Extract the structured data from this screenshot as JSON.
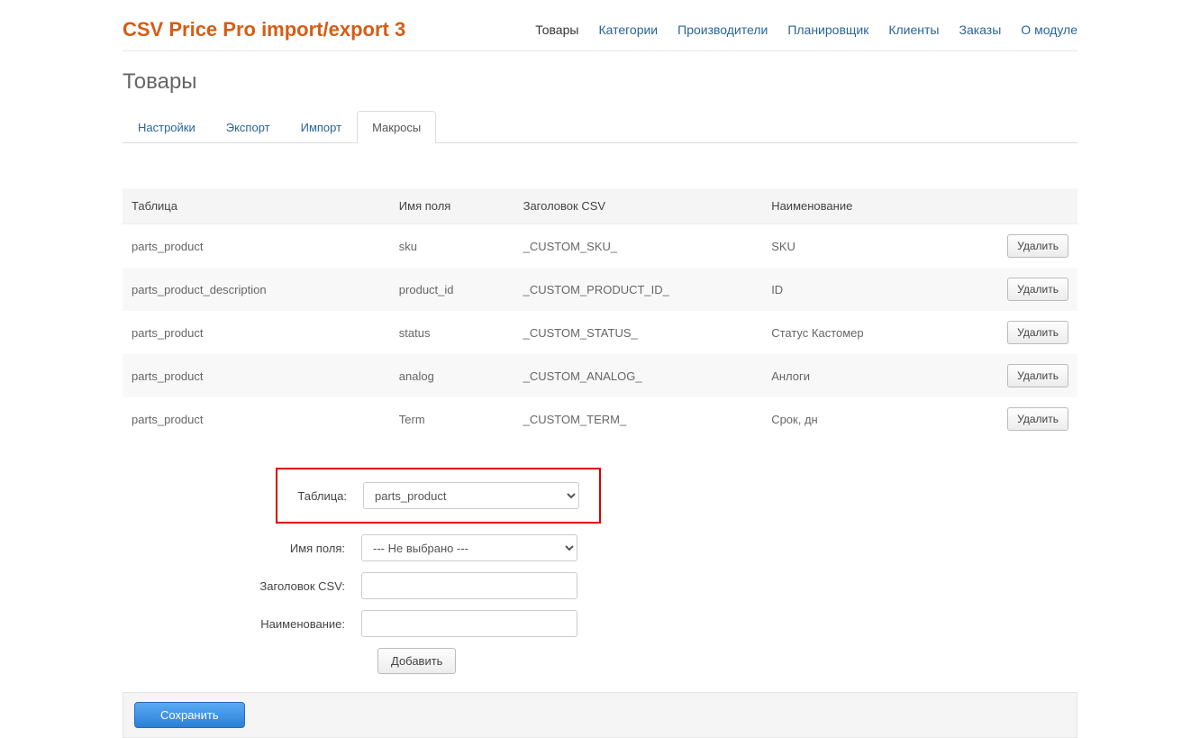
{
  "header": {
    "title": "CSV Price Pro import/export 3",
    "nav": [
      {
        "label": "Товары",
        "active": true
      },
      {
        "label": "Категории"
      },
      {
        "label": "Производители"
      },
      {
        "label": "Планировщик"
      },
      {
        "label": "Клиенты"
      },
      {
        "label": "Заказы"
      },
      {
        "label": "О модуле"
      }
    ]
  },
  "page_title": "Товары",
  "tabs": [
    {
      "label": "Настройки"
    },
    {
      "label": "Экспорт"
    },
    {
      "label": "Импорт"
    },
    {
      "label": "Макросы",
      "active": true
    }
  ],
  "table": {
    "headers": [
      "Таблица",
      "Имя поля",
      "Заголовок CSV",
      "Наименование",
      ""
    ],
    "rows": [
      {
        "table": "parts_product",
        "field": "sku",
        "csv": "_CUSTOM_SKU_",
        "name": "SKU",
        "delete": "Удалить"
      },
      {
        "table": "parts_product_description",
        "field": "product_id",
        "csv": "_CUSTOM_PRODUCT_ID_",
        "name": "ID",
        "delete": "Удалить"
      },
      {
        "table": "parts_product",
        "field": "status",
        "csv": "_CUSTOM_STATUS_",
        "name": "Статус Кастомер",
        "delete": "Удалить"
      },
      {
        "table": "parts_product",
        "field": "analog",
        "csv": "_CUSTOM_ANALOG_",
        "name": "Анлоги",
        "delete": "Удалить"
      },
      {
        "table": "parts_product",
        "field": "Term",
        "csv": "_CUSTOM_TERM_",
        "name": "Срок, дн",
        "delete": "Удалить"
      }
    ]
  },
  "form": {
    "table_label": "Таблица:",
    "table_value": "parts_product",
    "field_label": "Имя поля:",
    "field_value": "--- Не выбрано ---",
    "csv_label": "Заголовок CSV:",
    "csv_value": "",
    "name_label": "Наименование:",
    "name_value": "",
    "add_button": "Добавить"
  },
  "save_button": "Сохранить"
}
